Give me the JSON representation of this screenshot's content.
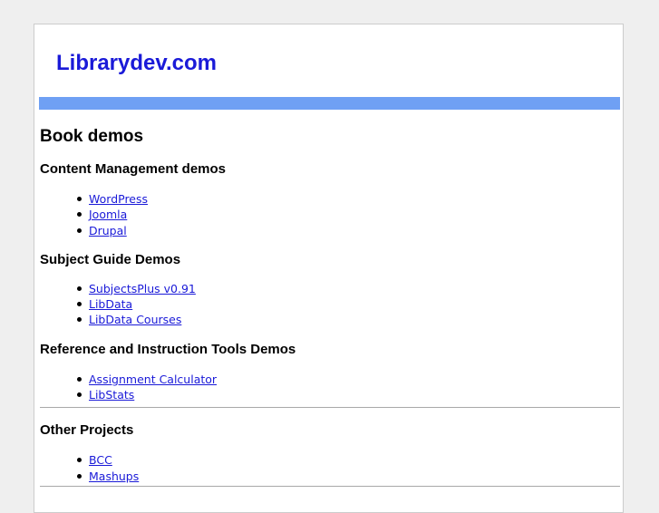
{
  "site": {
    "title": "Librarydev.com"
  },
  "main": {
    "heading": "Book demos",
    "sections": [
      {
        "title": "Content Management demos",
        "items": [
          "WordPress",
          "Joomla",
          "Drupal"
        ]
      },
      {
        "title": "Subject Guide Demos",
        "items": [
          "SubjectsPlus v0.91",
          "LibData",
          "LibData Courses"
        ]
      },
      {
        "title": "Reference and Instruction Tools Demos",
        "items": [
          "Assignment Calculator",
          "LibStats"
        ]
      }
    ],
    "other": {
      "title": "Other Projects",
      "items": [
        "BCC",
        "Mashups"
      ]
    }
  },
  "colors": {
    "link": "#1a1ad8",
    "banner": "#6fa0f4",
    "page_background": "#efefef"
  }
}
